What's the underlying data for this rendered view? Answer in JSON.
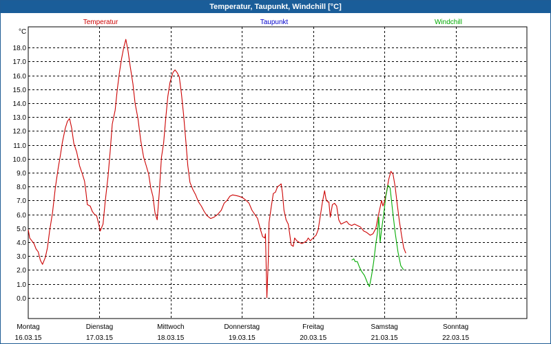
{
  "window": {
    "title": "Temperatur, Taupunkt, Windchill [°C]"
  },
  "colors": {
    "temperatur": "#cc0000",
    "taupunkt": "#0000cc",
    "windchill": "#00aa00",
    "grid": "#000000",
    "titlebar": "#1a5d99"
  },
  "chart_data": {
    "type": "line",
    "title": "Temperatur, Taupunkt, Windchill [°C]",
    "ylabel": "°C",
    "xlabel": "",
    "ylim": [
      -1.5,
      19.5
    ],
    "y_ticks": [
      0.0,
      1.0,
      2.0,
      3.0,
      4.0,
      5.0,
      6.0,
      7.0,
      8.0,
      9.0,
      10.0,
      11.0,
      12.0,
      13.0,
      14.0,
      15.0,
      16.0,
      17.0,
      18.0
    ],
    "xlim": [
      0,
      7
    ],
    "x_unit": "days from Montag 16.03.15 00:00",
    "day_labels": [
      {
        "weekday": "Montag",
        "date": "16.03.15"
      },
      {
        "weekday": "Dienstag",
        "date": "17.03.15"
      },
      {
        "weekday": "Mittwoch",
        "date": "18.03.15"
      },
      {
        "weekday": "Donnerstag",
        "date": "19.03.15"
      },
      {
        "weekday": "Freitag",
        "date": "20.03.15"
      },
      {
        "weekday": "Samstag",
        "date": "21.03.15"
      },
      {
        "weekday": "Sonntag",
        "date": "22.03.15"
      }
    ],
    "grid": true,
    "legend": [
      "Temperatur",
      "Taupunkt",
      "Windchill"
    ],
    "series": [
      {
        "name": "Temperatur",
        "color": "#cc0000",
        "points": [
          [
            0.0,
            4.9
          ],
          [
            0.02,
            4.3
          ],
          [
            0.05,
            4.1
          ],
          [
            0.08,
            3.9
          ],
          [
            0.11,
            3.5
          ],
          [
            0.14,
            3.3
          ],
          [
            0.17,
            2.7
          ],
          [
            0.2,
            2.4
          ],
          [
            0.24,
            2.9
          ],
          [
            0.27,
            3.6
          ],
          [
            0.3,
            4.8
          ],
          [
            0.34,
            6.1
          ],
          [
            0.38,
            7.9
          ],
          [
            0.42,
            9.3
          ],
          [
            0.45,
            10.2
          ],
          [
            0.48,
            11.2
          ],
          [
            0.52,
            12.2
          ],
          [
            0.55,
            12.7
          ],
          [
            0.58,
            12.9
          ],
          [
            0.61,
            12.2
          ],
          [
            0.64,
            11.1
          ],
          [
            0.68,
            10.5
          ],
          [
            0.72,
            9.5
          ],
          [
            0.76,
            8.9
          ],
          [
            0.79,
            8.4
          ],
          [
            0.81,
            7.6
          ],
          [
            0.83,
            6.7
          ],
          [
            0.87,
            6.6
          ],
          [
            0.9,
            6.2
          ],
          [
            0.93,
            6.0
          ],
          [
            0.96,
            5.9
          ],
          [
            0.99,
            5.3
          ],
          [
            1.01,
            4.8
          ],
          [
            1.05,
            5.3
          ],
          [
            1.08,
            6.9
          ],
          [
            1.12,
            8.7
          ],
          [
            1.15,
            10.5
          ],
          [
            1.18,
            12.5
          ],
          [
            1.22,
            13.5
          ],
          [
            1.25,
            15.0
          ],
          [
            1.28,
            16.2
          ],
          [
            1.31,
            17.2
          ],
          [
            1.34,
            18.0
          ],
          [
            1.37,
            18.6
          ],
          [
            1.4,
            17.8
          ],
          [
            1.43,
            16.7
          ],
          [
            1.47,
            15.4
          ],
          [
            1.5,
            14.0
          ],
          [
            1.54,
            12.9
          ],
          [
            1.58,
            11.3
          ],
          [
            1.62,
            10.1
          ],
          [
            1.65,
            9.6
          ],
          [
            1.69,
            8.9
          ],
          [
            1.72,
            7.9
          ],
          [
            1.75,
            7.3
          ],
          [
            1.78,
            6.1
          ],
          [
            1.81,
            5.6
          ],
          [
            1.84,
            7.6
          ],
          [
            1.87,
            10.1
          ],
          [
            1.9,
            11.1
          ],
          [
            1.93,
            12.9
          ],
          [
            1.96,
            14.5
          ],
          [
            1.99,
            15.5
          ],
          [
            2.03,
            16.2
          ],
          [
            2.06,
            16.4
          ],
          [
            2.09,
            16.2
          ],
          [
            2.12,
            15.9
          ],
          [
            2.15,
            14.7
          ],
          [
            2.18,
            13.2
          ],
          [
            2.21,
            11.4
          ],
          [
            2.24,
            9.5
          ],
          [
            2.27,
            8.3
          ],
          [
            2.31,
            7.8
          ],
          [
            2.35,
            7.4
          ],
          [
            2.39,
            6.9
          ],
          [
            2.43,
            6.6
          ],
          [
            2.47,
            6.2
          ],
          [
            2.51,
            5.9
          ],
          [
            2.56,
            5.7
          ],
          [
            2.61,
            5.8
          ],
          [
            2.66,
            6.0
          ],
          [
            2.71,
            6.3
          ],
          [
            2.75,
            6.8
          ],
          [
            2.79,
            7.0
          ],
          [
            2.83,
            7.3
          ],
          [
            2.87,
            7.4
          ],
          [
            2.92,
            7.35
          ],
          [
            2.96,
            7.3
          ],
          [
            3.01,
            7.2
          ],
          [
            3.06,
            7.0
          ],
          [
            3.1,
            6.8
          ],
          [
            3.14,
            6.3
          ],
          [
            3.18,
            6.0
          ],
          [
            3.22,
            5.7
          ],
          [
            3.26,
            4.9
          ],
          [
            3.29,
            4.4
          ],
          [
            3.32,
            4.3
          ],
          [
            3.33,
            4.6
          ],
          [
            3.35,
            0.0
          ],
          [
            3.37,
            2.8
          ],
          [
            3.38,
            5.4
          ],
          [
            3.41,
            6.5
          ],
          [
            3.44,
            7.5
          ],
          [
            3.47,
            7.6
          ],
          [
            3.5,
            8.0
          ],
          [
            3.53,
            8.1
          ],
          [
            3.55,
            8.2
          ],
          [
            3.57,
            7.5
          ],
          [
            3.59,
            6.3
          ],
          [
            3.62,
            5.6
          ],
          [
            3.65,
            5.3
          ],
          [
            3.67,
            4.6
          ],
          [
            3.69,
            3.8
          ],
          [
            3.72,
            3.7
          ],
          [
            3.74,
            4.3
          ],
          [
            3.77,
            4.1
          ],
          [
            3.8,
            4.0
          ],
          [
            3.84,
            3.9
          ],
          [
            3.88,
            4.0
          ],
          [
            3.91,
            4.1
          ],
          [
            3.93,
            4.3
          ],
          [
            3.96,
            4.1
          ],
          [
            4.0,
            4.3
          ],
          [
            4.04,
            4.5
          ],
          [
            4.07,
            4.9
          ],
          [
            4.1,
            5.9
          ],
          [
            4.13,
            6.9
          ],
          [
            4.16,
            7.7
          ],
          [
            4.18,
            7.1
          ],
          [
            4.2,
            6.9
          ],
          [
            4.22,
            6.9
          ],
          [
            4.24,
            5.8
          ],
          [
            4.27,
            6.7
          ],
          [
            4.3,
            6.8
          ],
          [
            4.33,
            6.6
          ],
          [
            4.36,
            5.6
          ],
          [
            4.39,
            5.3
          ],
          [
            4.43,
            5.4
          ],
          [
            4.47,
            5.5
          ],
          [
            4.5,
            5.3
          ],
          [
            4.54,
            5.2
          ],
          [
            4.58,
            5.3
          ],
          [
            4.62,
            5.2
          ],
          [
            4.66,
            5.1
          ],
          [
            4.71,
            4.8
          ],
          [
            4.75,
            4.7
          ],
          [
            4.8,
            4.5
          ],
          [
            4.84,
            4.6
          ],
          [
            4.88,
            5.0
          ],
          [
            4.91,
            5.8
          ],
          [
            4.94,
            6.5
          ],
          [
            4.96,
            7.0
          ],
          [
            4.98,
            6.6
          ],
          [
            5.0,
            6.9
          ],
          [
            5.03,
            7.6
          ],
          [
            5.06,
            8.5
          ],
          [
            5.09,
            9.1
          ],
          [
            5.12,
            8.9
          ],
          [
            5.15,
            8.0
          ],
          [
            5.18,
            6.7
          ],
          [
            5.21,
            5.5
          ],
          [
            5.24,
            4.5
          ],
          [
            5.27,
            3.6
          ],
          [
            5.3,
            3.2
          ]
        ]
      },
      {
        "name": "Taupunkt",
        "color": "#0000cc",
        "points": []
      },
      {
        "name": "Windchill",
        "color": "#00aa00",
        "points": [
          [
            4.54,
            2.7
          ],
          [
            4.57,
            2.8
          ],
          [
            4.59,
            2.6
          ],
          [
            4.62,
            2.6
          ],
          [
            4.65,
            2.2
          ],
          [
            4.68,
            1.9
          ],
          [
            4.72,
            1.6
          ],
          [
            4.76,
            1.1
          ],
          [
            4.79,
            0.8
          ],
          [
            4.82,
            1.6
          ],
          [
            4.85,
            2.6
          ],
          [
            4.88,
            3.9
          ],
          [
            4.9,
            4.6
          ],
          [
            4.92,
            5.8
          ],
          [
            4.94,
            4.0
          ],
          [
            4.96,
            4.9
          ],
          [
            4.99,
            6.0
          ],
          [
            5.02,
            7.3
          ],
          [
            5.05,
            8.1
          ],
          [
            5.08,
            7.9
          ],
          [
            5.11,
            6.5
          ],
          [
            5.15,
            4.7
          ],
          [
            5.19,
            3.3
          ],
          [
            5.23,
            2.3
          ],
          [
            5.27,
            2.0
          ]
        ]
      }
    ]
  }
}
